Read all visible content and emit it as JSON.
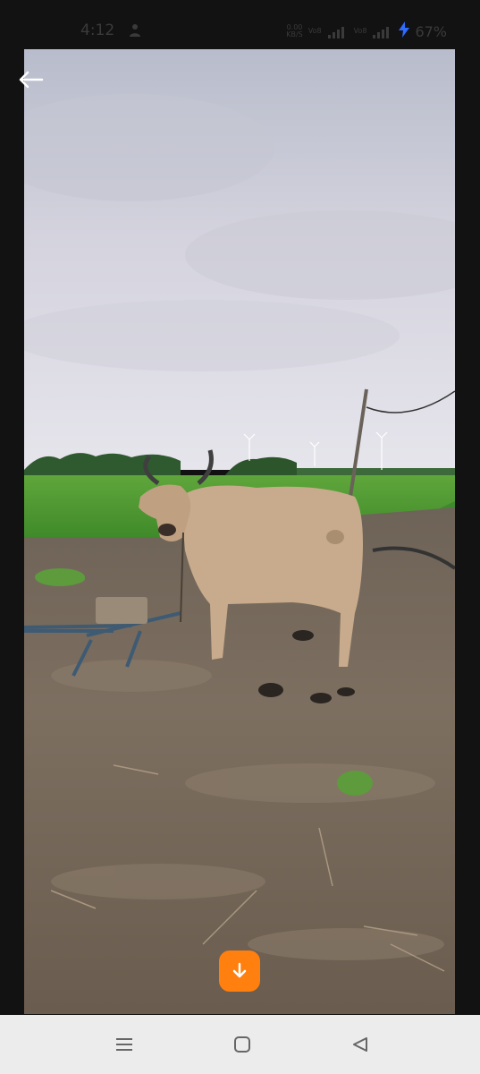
{
  "status_bar": {
    "time": "4:12",
    "net_speed_value": "0.00",
    "net_speed_unit": "KB/S",
    "volte_label": "Vo8",
    "sim2_label": "Vo8",
    "battery_percent": "67%",
    "icons": [
      "person-icon",
      "signal-icon",
      "signal-icon",
      "charging-icon"
    ]
  },
  "viewer": {
    "back_icon": "arrow-left-icon",
    "download_icon": "arrow-down-icon",
    "accent_color": "#ff7f0f"
  },
  "navigation": {
    "buttons": [
      "menu-icon",
      "home-icon",
      "back-triangle-icon"
    ]
  }
}
